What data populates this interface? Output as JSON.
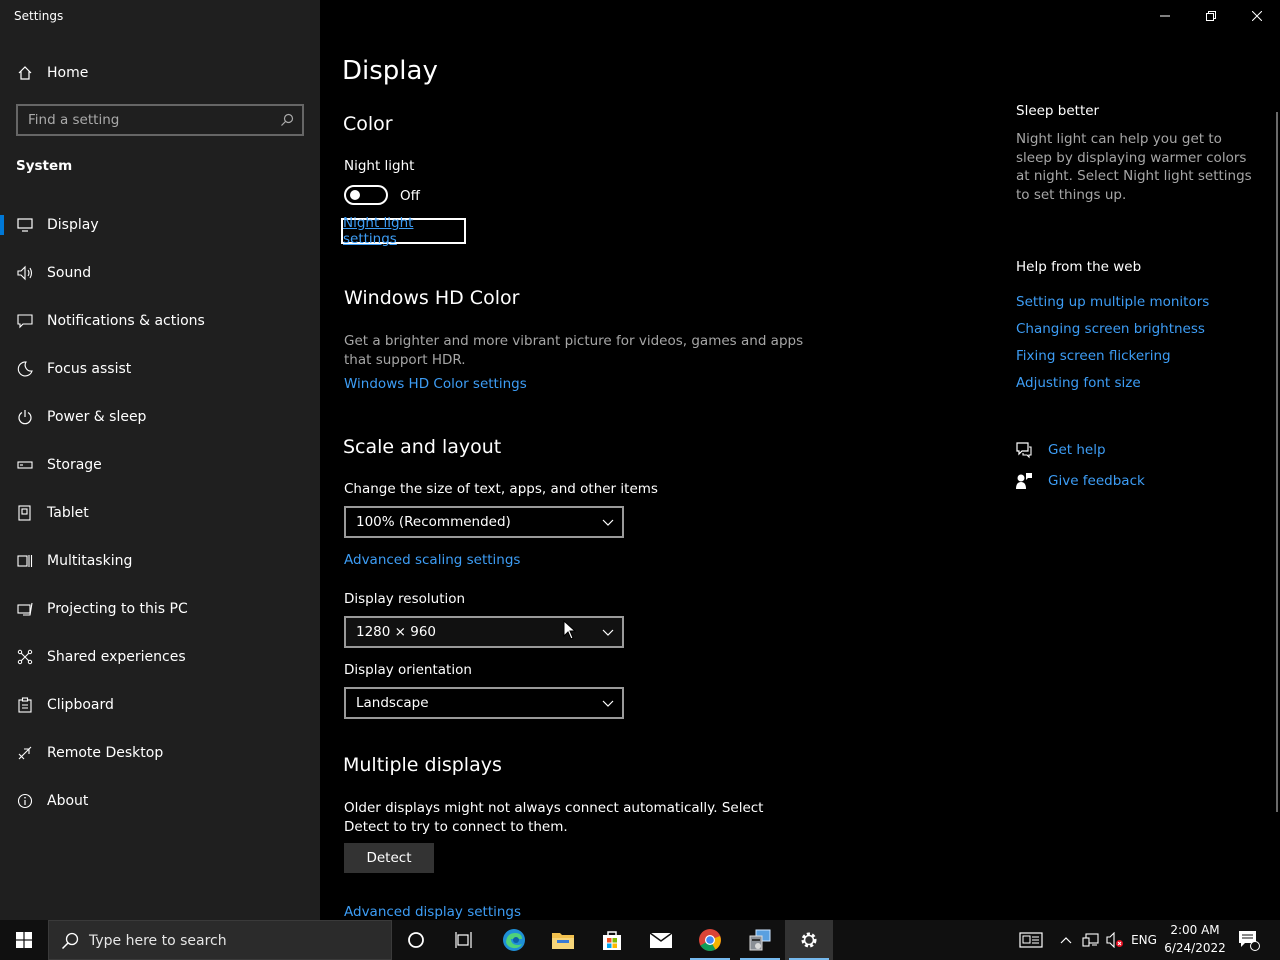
{
  "window": {
    "title": "Settings"
  },
  "sidebar": {
    "home_label": "Home",
    "search_placeholder": "Find a setting",
    "section_label": "System",
    "items": [
      {
        "label": "Display",
        "icon": "monitor-icon",
        "selected": true
      },
      {
        "label": "Sound",
        "icon": "speaker-icon"
      },
      {
        "label": "Notifications & actions",
        "icon": "message-icon"
      },
      {
        "label": "Focus assist",
        "icon": "moon-icon"
      },
      {
        "label": "Power & sleep",
        "icon": "power-icon"
      },
      {
        "label": "Storage",
        "icon": "storage-icon"
      },
      {
        "label": "Tablet",
        "icon": "tablet-icon"
      },
      {
        "label": "Multitasking",
        "icon": "multitasking-icon"
      },
      {
        "label": "Projecting to this PC",
        "icon": "projecting-icon"
      },
      {
        "label": "Shared experiences",
        "icon": "shared-icon"
      },
      {
        "label": "Clipboard",
        "icon": "clipboard-icon"
      },
      {
        "label": "Remote Desktop",
        "icon": "remote-desktop-icon"
      },
      {
        "label": "About",
        "icon": "info-icon"
      }
    ]
  },
  "main": {
    "page_title": "Display",
    "color": {
      "heading": "Color",
      "night_light_label": "Night light",
      "toggle_state": "Off",
      "night_light_settings_link": "Night light settings"
    },
    "hd_color": {
      "heading": "Windows HD Color",
      "description": "Get a brighter and more vibrant picture for videos, games and apps that support HDR.",
      "link": "Windows HD Color settings"
    },
    "scale_layout": {
      "heading": "Scale and layout",
      "scale_label": "Change the size of text, apps, and other items",
      "scale_value": "100% (Recommended)",
      "advanced_scaling_link": "Advanced scaling settings",
      "resolution_label": "Display resolution",
      "resolution_value": "1280 × 960",
      "orientation_label": "Display orientation",
      "orientation_value": "Landscape"
    },
    "multiple_displays": {
      "heading": "Multiple displays",
      "description": "Older displays might not always connect automatically. Select Detect to try to connect to them.",
      "detect_button": "Detect",
      "advanced_display_link": "Advanced display settings"
    }
  },
  "aside": {
    "sleep_title": "Sleep better",
    "sleep_text": "Night light can help you get to sleep by displaying warmer colors at night. Select Night light settings to set things up.",
    "help_title": "Help from the web",
    "help_links": [
      "Setting up multiple monitors",
      "Changing screen brightness",
      "Fixing screen flickering",
      "Adjusting font size"
    ],
    "get_help": "Get help",
    "give_feedback": "Give feedback"
  },
  "taskbar": {
    "search_placeholder": "Type here to search",
    "language": "ENG",
    "time": "2:00 AM",
    "date": "6/24/2022"
  },
  "colors": {
    "accent": "#0078d7",
    "link": "#3d9df5",
    "sidebar_bg": "#1f1f1f",
    "taskbar_bg": "#101010"
  }
}
